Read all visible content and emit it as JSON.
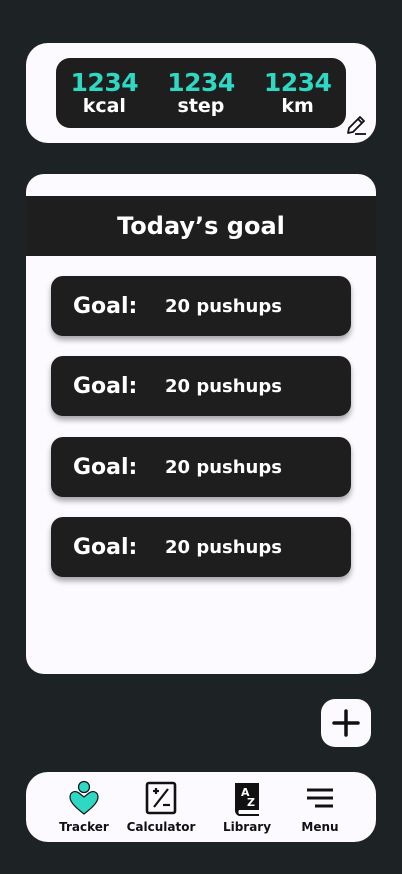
{
  "stats": [
    {
      "value": "1234",
      "unit": "kcal"
    },
    {
      "value": "1234",
      "unit": "step"
    },
    {
      "value": "1234",
      "unit": "km"
    }
  ],
  "goals": {
    "title": "Today’s goal",
    "items": [
      {
        "label": "Goal:",
        "value": "20 pushups"
      },
      {
        "label": "Goal:",
        "value": "20 pushups"
      },
      {
        "label": "Goal:",
        "value": "20 pushups"
      },
      {
        "label": "Goal:",
        "value": "20 pushups"
      }
    ]
  },
  "nav": {
    "items": [
      {
        "label": "Tracker",
        "icon": "tracker-icon"
      },
      {
        "label": "Calculator",
        "icon": "calculator-icon"
      },
      {
        "label": "Library",
        "icon": "library-icon"
      },
      {
        "label": "Menu",
        "icon": "menu-icon"
      }
    ]
  },
  "colors": {
    "accent": "#2ed8c3",
    "dark": "#1e1e1e",
    "card": "#fdfaff",
    "background": "#1d2324"
  }
}
